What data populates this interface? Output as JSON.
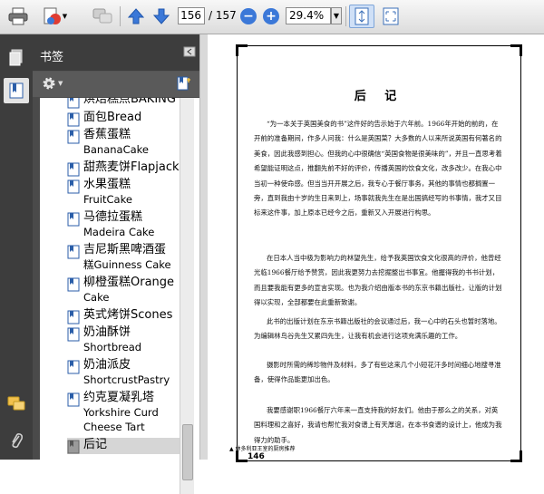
{
  "toolbar": {
    "page_current": "156",
    "page_total": "/ 157",
    "zoom": "29.4%",
    "zoom_out_symbol": "−",
    "zoom_in_symbol": "+"
  },
  "panel": {
    "title": "书签"
  },
  "bookmarks": [
    {
      "label": "烘焙糕点BAKING"
    },
    {
      "label": "面包Bread"
    },
    {
      "label": "香蕉蛋糕",
      "label2": "BananaCake"
    },
    {
      "label": "甜燕麦饼Flapjack"
    },
    {
      "label": "水果蛋糕",
      "label2": "FruitCake"
    },
    {
      "label": "马德拉蛋糕",
      "label2": "Madeira Cake"
    },
    {
      "label": "吉尼斯黑啤酒蛋",
      "label2": "糕Guinness Cake"
    },
    {
      "label": "柳橙蛋糕Orange",
      "label2": "Cake"
    },
    {
      "label": "英式烤饼Scones"
    },
    {
      "label": "奶油酥饼",
      "label2": "Shortbread"
    },
    {
      "label": "奶油派皮",
      "label2": "ShortcrustPastry"
    },
    {
      "label": "约克夏凝乳塔",
      "label2": "Yorkshire Curd",
      "label3": "Cheese Tart"
    },
    {
      "label": "后记"
    }
  ],
  "document": {
    "title": "后 记",
    "paragraphs": [
      "“为一本关于英国美食的书”这件好的告示始于六年前。1966年开始的前的，在开前的准备期间，作多人问我：什么是英国菜？大多数的人以来所说英国有何著名的美食，因此我感到担心。但我的心中很确信“英国食物是很美味的”，并且一直思考着希望能证明这点，推翻先前不好的评价，传播英国的饮食文化，改多改少。在我心中当初一种使命感。但当当开开展之后，我专心于餐厅事务，其他的事情也都搁置一旁，直到我由十岁的生日来到上，场事就我先生在是出国搞经写的书事情，我才又目标来这件事，加上原本已经今之后，重新又入开展进行构思。",
      "在日本人当中极为影响力的林望先生，给予我英国饮食文化很高的评价，他曾经光临1966餐厅给予赞赏，因此我更努力去挖掘整出书事宜。他握得我的书书计划，而且要我能有更多的宣言实现。也为我介绍由版本书的东京书籍出版社，让版的计划得以实现，全部都要在此重新致谢。",
      "此书的出版计划在东京书籍出版社的会议通过后，我一心中的石头也暂时落地。为编辑林鸟谷先生又累四先生，让我有机会进行这项充满乐趣的工作。",
      "摄影时所需的稀珍物件及材料，多了有些这来几个小短花汗多时间细心地搜寻准备，使得作品能更加出色。",
      "我要感谢职1966餐厅六年来一直支持我的好友们。他由于那么之的关系，对英国料理和之喜好，我请也帮忙我对食谱上有天厚谊，在本书食谱的设计上，他成为我得力的助手。"
    ],
    "footer": "▲ 林多利亚王室的厨房推荐",
    "page_number": "146"
  }
}
